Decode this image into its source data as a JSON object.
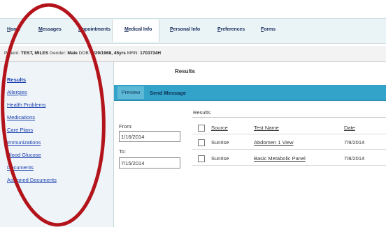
{
  "nav": {
    "items": [
      {
        "label": "Home"
      },
      {
        "label": "Messages"
      },
      {
        "label": "Appointments"
      },
      {
        "label": "Medical Info"
      },
      {
        "label": "Personal Info"
      },
      {
        "label": "Preferences"
      },
      {
        "label": "Forms"
      }
    ]
  },
  "patient": {
    "name_label": "Patient:",
    "name": "TEST, MILES",
    "gender_label": "Gender:",
    "gender": "Male",
    "dob_label": "DOB:",
    "dob": "9/29/1968, 45yrs",
    "mrn_label": "MRN:",
    "mrn": "1703734H"
  },
  "sidebar": {
    "items": [
      {
        "label": "Results"
      },
      {
        "label": "Allergies"
      },
      {
        "label": "Health Problems"
      },
      {
        "label": "Medications"
      },
      {
        "label": "Care Plans"
      },
      {
        "label": "Immunizations"
      },
      {
        "label": "Blood Glucose"
      },
      {
        "label": "Documents"
      },
      {
        "label": "Assigned Documents"
      }
    ]
  },
  "main": {
    "title": "Results",
    "actions": {
      "preview": "Preview",
      "send_message": "Send Message"
    },
    "filters": {
      "from_label": "From:",
      "from_value": "1/16/2014",
      "to_label": "To:",
      "to_value": "7/15/2014"
    },
    "results_label": "Results",
    "table": {
      "headers": {
        "source": "Source",
        "test_name": "Test Name",
        "date": "Date"
      },
      "rows": [
        {
          "source": "Sunrise",
          "test_name": "Abdomen 1 View",
          "date": "7/9/2014"
        },
        {
          "source": "Sunrise",
          "test_name": "Basic Metabolic Panel",
          "date": "7/8/2014"
        }
      ]
    }
  },
  "colors": {
    "annotation": "#b3141b",
    "action_bar": "#34a3c9",
    "link": "#1a3fb0"
  }
}
